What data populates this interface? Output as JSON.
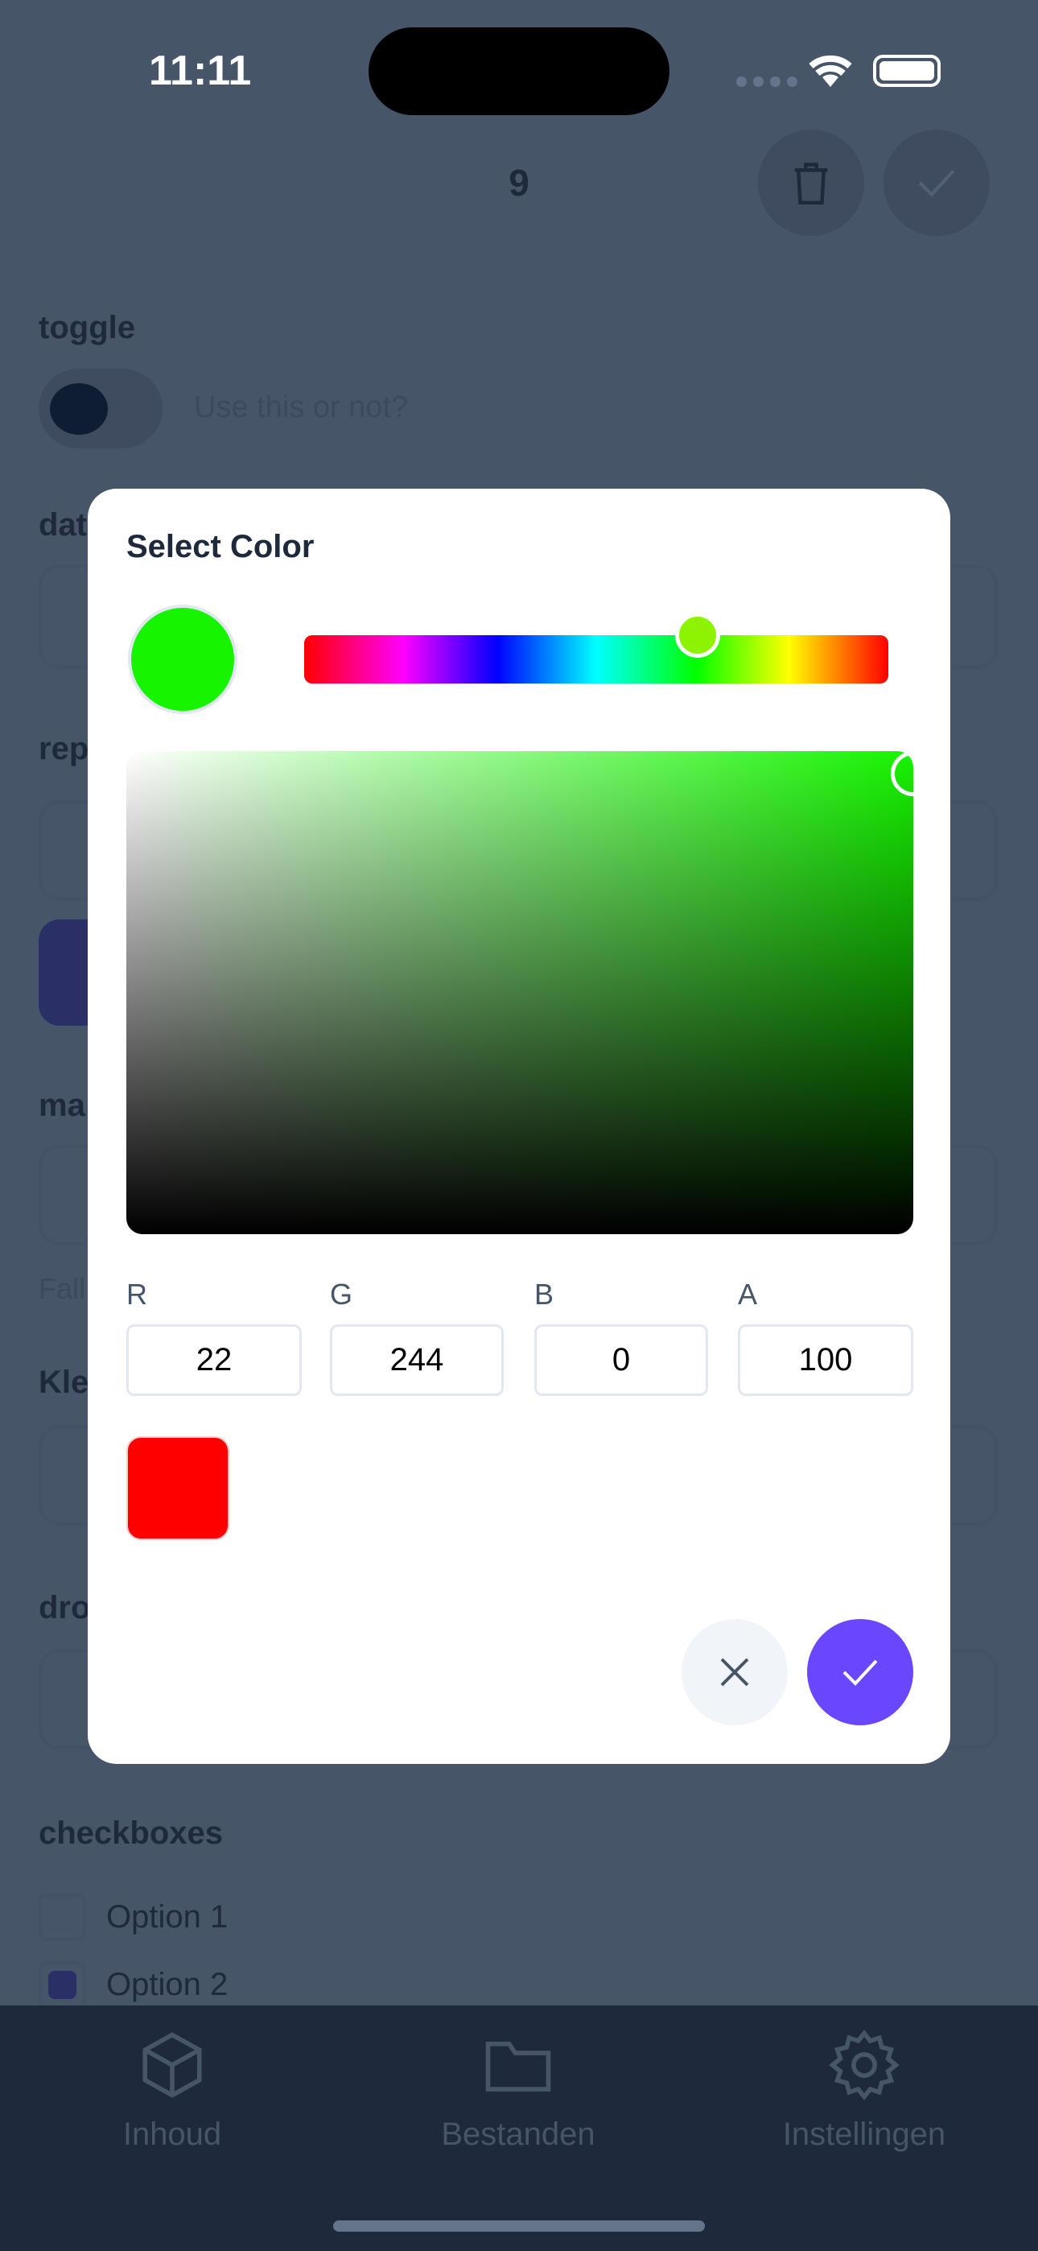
{
  "status_bar": {
    "time": "11:11"
  },
  "header": {
    "title": "9",
    "delete_icon": "trash-icon",
    "confirm_icon": "check-icon"
  },
  "form": {
    "toggle": {
      "label": "toggle",
      "description": "Use this or not?",
      "value": false
    },
    "date": {
      "label": "dat"
    },
    "repeat": {
      "label": "rep"
    },
    "ma": {
      "label": "ma",
      "hint": "Fall"
    },
    "color": {
      "label": "Kle"
    },
    "dropdown": {
      "label": "dro"
    },
    "checkboxes": {
      "label": "checkboxes",
      "options": [
        {
          "label": "Option 1",
          "checked": false
        },
        {
          "label": "Option 2",
          "checked": true
        }
      ]
    }
  },
  "color_dialog": {
    "title": "Select Color",
    "current_color": "#16f400",
    "swatch_color": "#ff0000",
    "channels": [
      {
        "label": "R",
        "value": "22"
      },
      {
        "label": "G",
        "value": "244"
      },
      {
        "label": "B",
        "value": "0"
      },
      {
        "label": "A",
        "value": "100"
      }
    ],
    "cancel_icon": "close-icon",
    "confirm_icon": "check-icon",
    "confirm_color": "#6b46ff"
  },
  "tab_bar": {
    "items": [
      {
        "label": "Inhoud",
        "icon": "cube-icon"
      },
      {
        "label": "Bestanden",
        "icon": "folder-icon"
      },
      {
        "label": "Instellingen",
        "icon": "gear-icon"
      }
    ]
  }
}
